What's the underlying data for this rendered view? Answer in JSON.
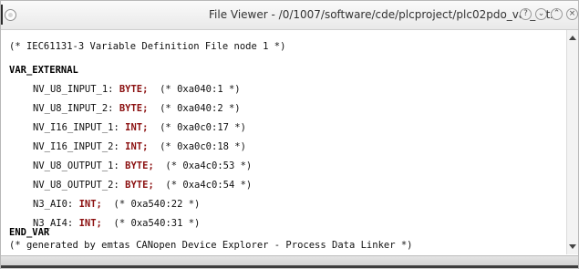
{
  "window": {
    "title": "File Viewer - /0/1007/software/cde/plcproject/plc02pdo_var_1.txt",
    "controls": [
      {
        "name": "help",
        "glyph": "?"
      },
      {
        "name": "minimize",
        "glyph": "⌄"
      },
      {
        "name": "maximize",
        "glyph": "⌃"
      },
      {
        "name": "close",
        "glyph": "×"
      }
    ]
  },
  "file": {
    "header_comment": "(* IEC61131-3 Variable Definition File node 1 *)",
    "var_block_start": "VAR_EXTERNAL",
    "variables": [
      {
        "name": "NV_U8_INPUT_1:",
        "type": "BYTE;",
        "address": "(* 0xa040:1 *)"
      },
      {
        "name": "NV_U8_INPUT_2:",
        "type": "BYTE;",
        "address": "(* 0xa040:2 *)"
      },
      {
        "name": "NV_I16_INPUT_1:",
        "type": "INT;",
        "address": "(* 0xa0c0:17 *)"
      },
      {
        "name": "NV_I16_INPUT_2:",
        "type": "INT;",
        "address": "(* 0xa0c0:18 *)"
      },
      {
        "name": "NV_U8_OUTPUT_1:",
        "type": "BYTE;",
        "address": "(* 0xa4c0:53 *)"
      },
      {
        "name": "NV_U8_OUTPUT_2:",
        "type": "BYTE;",
        "address": "(* 0xa4c0:54 *)"
      },
      {
        "name": "N3_AI0:",
        "type": "INT;",
        "address": "(* 0xa540:22 *)"
      },
      {
        "name": "N3_AI4:",
        "type": "INT;",
        "address": "(* 0xa540:31 *)"
      }
    ],
    "var_block_end": "END_VAR",
    "footer_comment": "(* generated by emtas CANopen Device Explorer - Process Data Linker *)"
  },
  "colors": {
    "type_keyword": "#8b1010",
    "text": "#111111"
  }
}
